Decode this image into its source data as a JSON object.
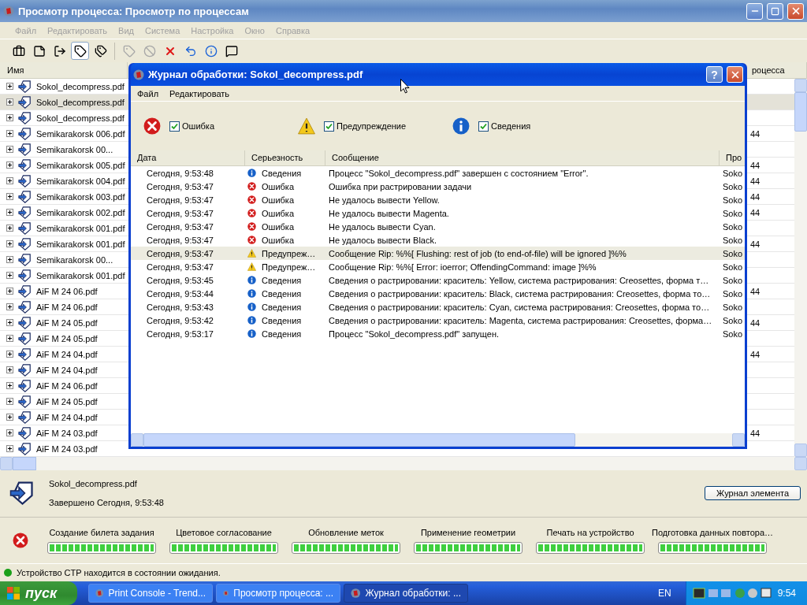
{
  "window": {
    "title": "Просмотр процесса: Просмотр по процессам"
  },
  "menu": [
    "Файл",
    "Редактировать",
    "Вид",
    "Система",
    "Настройка",
    "Окно",
    "Справка"
  ],
  "toolbar": [
    {
      "kind": "briefcase",
      "pressed": false,
      "disabled": false
    },
    {
      "kind": "page",
      "pressed": false,
      "disabled": false
    },
    {
      "kind": "exit",
      "pressed": false,
      "disabled": false
    },
    {
      "kind": "tag",
      "pressed": true,
      "disabled": false
    },
    {
      "kind": "tags",
      "pressed": false,
      "disabled": false
    },
    {
      "kind": "separator"
    },
    {
      "kind": "tag",
      "pressed": false,
      "disabled": true
    },
    {
      "kind": "stop",
      "pressed": false,
      "disabled": true
    },
    {
      "kind": "cross",
      "pressed": false,
      "disabled": false
    },
    {
      "kind": "refresh",
      "pressed": false,
      "disabled": false
    },
    {
      "kind": "info",
      "pressed": false,
      "disabled": false
    },
    {
      "kind": "speech",
      "pressed": false,
      "disabled": false
    }
  ],
  "process_list": {
    "columns": [
      "Имя",
      "роцесса"
    ],
    "rows": [
      {
        "name": "Sokol_decompress.pdf",
        "selected": false
      },
      {
        "name": "Sokol_decompress.pdf",
        "selected": true
      },
      {
        "name": "Sokol_decompress.pdf",
        "selected": false
      },
      {
        "name": "Semikarakorsk 006.pdf",
        "selected": false,
        "column_2": "44"
      },
      {
        "name": "Semikarakorsk 00...",
        "selected": false
      },
      {
        "name": "Semikarakorsk 005.pdf",
        "selected": false,
        "column_2": "44"
      },
      {
        "name": "Semikarakorsk 004.pdf",
        "selected": false,
        "column_2": "44"
      },
      {
        "name": "Semikarakorsk 003.pdf",
        "selected": false,
        "column_2": "44"
      },
      {
        "name": "Semikarakorsk 002.pdf",
        "selected": false,
        "column_2": "44"
      },
      {
        "name": "Semikarakorsk 001.pdf",
        "selected": false
      },
      {
        "name": "Semikarakorsk 001.pdf",
        "selected": false,
        "column_2": "44"
      },
      {
        "name": "Semikarakorsk 00...",
        "selected": false
      },
      {
        "name": "Semikarakorsk 001.pdf",
        "selected": false
      },
      {
        "name": "AiF M 24 06.pdf",
        "selected": false,
        "column_2": "44"
      },
      {
        "name": "AiF M 24 06.pdf",
        "selected": false
      },
      {
        "name": "AiF M 24 05.pdf",
        "selected": false,
        "column_2": "44"
      },
      {
        "name": "AiF M 24 05.pdf",
        "selected": false
      },
      {
        "name": "AiF M 24 04.pdf",
        "selected": false,
        "column_2": "44"
      },
      {
        "name": "AiF M 24 04.pdf",
        "selected": false
      },
      {
        "name": "AiF M 24 06.pdf",
        "selected": false
      },
      {
        "name": "AiF M 24 05.pdf",
        "selected": false
      },
      {
        "name": "AiF M 24 04.pdf",
        "selected": false
      },
      {
        "name": "AiF M 24 03.pdf",
        "selected": false,
        "column_2": "44"
      },
      {
        "name": "AiF M 24 03.pdf",
        "selected": false
      }
    ]
  },
  "log_dialog": {
    "title": "Журнал обработки:  Sokol_decompress.pdf",
    "help": "?",
    "menu": [
      "Файл",
      "Редактировать"
    ],
    "filters": [
      {
        "kind": "error",
        "label": "Ошибка",
        "checked": true
      },
      {
        "kind": "warning",
        "label": "Предупреждение",
        "checked": true
      },
      {
        "kind": "info",
        "label": "Сведения",
        "checked": true
      }
    ],
    "columns": [
      "Дата",
      "Серьезность",
      "Сообщение",
      "Про"
    ],
    "rows": [
      {
        "date": "Сегодня, 9:53:48",
        "kind": "info",
        "severity": "Сведения",
        "message": "Процесс \"Sokol_decompress.pdf\" завершен с состоянием \"Error\".",
        "column_4": "Soko",
        "selected": false
      },
      {
        "date": "Сегодня, 9:53:47",
        "kind": "error",
        "severity": "Ошибка",
        "message": "Ошибка при растрировании задачи",
        "column_4": "Soko",
        "selected": false
      },
      {
        "date": "Сегодня, 9:53:47",
        "kind": "error",
        "severity": "Ошибка",
        "message": "Не удалось вывести Yellow.",
        "column_4": "Soko",
        "selected": false
      },
      {
        "date": "Сегодня, 9:53:47",
        "kind": "error",
        "severity": "Ошибка",
        "message": "Не удалось вывести Magenta.",
        "column_4": "Soko",
        "selected": false
      },
      {
        "date": "Сегодня, 9:53:47",
        "kind": "error",
        "severity": "Ошибка",
        "message": "Не удалось вывести Cyan.",
        "column_4": "Soko",
        "selected": false
      },
      {
        "date": "Сегодня, 9:53:47",
        "kind": "error",
        "severity": "Ошибка",
        "message": "Не удалось вывести Black.",
        "column_4": "Soko",
        "selected": false
      },
      {
        "date": "Сегодня, 9:53:47",
        "kind": "warning",
        "severity": "Предупреж…",
        "message": "Сообщение Rip: %%[ Flushing: rest of job (to end-of-file) will be ignored ]%%",
        "column_4": "Soko",
        "selected": true
      },
      {
        "date": "Сегодня, 9:53:47",
        "kind": "warning",
        "severity": "Предупреж…",
        "message": "Сообщение Rip: %%[ Error: ioerror; OffendingCommand: image ]%%",
        "column_4": "Soko",
        "selected": false
      },
      {
        "date": "Сегодня, 9:53:45",
        "kind": "info",
        "severity": "Сведения",
        "message": "Сведения о растрировании: краситель: Yellow, система растрирования: Creosettes, форма т…",
        "column_4": "Soko",
        "selected": false
      },
      {
        "date": "Сегодня, 9:53:44",
        "kind": "info",
        "severity": "Сведения",
        "message": "Сведения о растрировании: краситель: Black, система растрирования: Creosettes, форма то…",
        "column_4": "Soko",
        "selected": false
      },
      {
        "date": "Сегодня, 9:53:43",
        "kind": "info",
        "severity": "Сведения",
        "message": "Сведения о растрировании: краситель: Cyan, система растрирования: Creosettes, форма то…",
        "column_4": "Soko",
        "selected": false
      },
      {
        "date": "Сегодня, 9:53:42",
        "kind": "info",
        "severity": "Сведения",
        "message": "Сведения о растрировании: краситель: Magenta, система растрирования: Creosettes, форма…",
        "column_4": "Soko",
        "selected": false
      },
      {
        "date": "Сегодня, 9:53:17",
        "kind": "info",
        "severity": "Сведения",
        "message": "Процесс \"Sokol_decompress.pdf\" запущен.",
        "column_4": "Soko",
        "selected": false
      }
    ]
  },
  "details": {
    "name": "Sokol_decompress.pdf",
    "status": "Завершено Сегодня, 9:53:48",
    "button": "Журнал элемента"
  },
  "stages": {
    "kind": "error",
    "items": [
      {
        "label": "Создание билета задания",
        "level": 1
      },
      {
        "label": "Цветовое согласование",
        "level": 1
      },
      {
        "label": "Обновление меток",
        "level": 1
      },
      {
        "label": "Применение геометрии",
        "level": 1
      },
      {
        "label": "Печать на устройство",
        "level": 1
      },
      {
        "label": "Подготовка данных повтора…",
        "level": 1
      }
    ]
  },
  "status_bar": {
    "text": "Устройство CTP находится в состоянии ожидания.",
    "color": "#1aa01a"
  },
  "taskbar": {
    "start": "пуск",
    "tasks": [
      {
        "label": "Print Console - Trend...",
        "selected": false
      },
      {
        "label": "Просмотр процесса: ...",
        "selected": false
      },
      {
        "label": "Журнал обработки: ...",
        "selected": true
      }
    ],
    "language": "EN",
    "clock": "9:54"
  }
}
